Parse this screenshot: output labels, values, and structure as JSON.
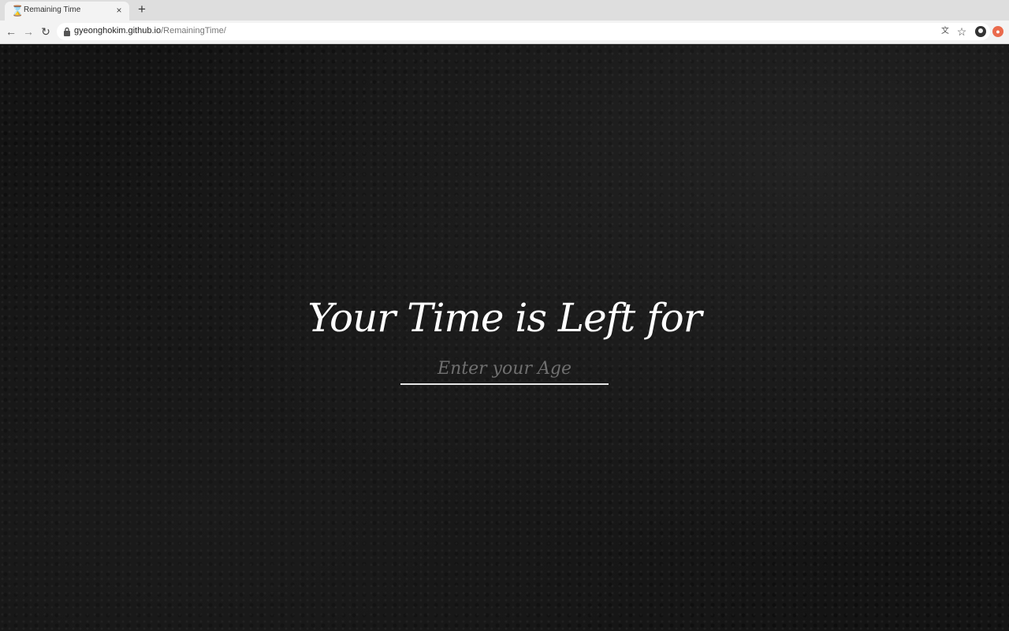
{
  "browser": {
    "tab": {
      "title": "Remaining Time",
      "favicon_icon": "hourglass-icon",
      "close_glyph": "×"
    },
    "new_tab_glyph": "+",
    "nav": {
      "back_glyph": "←",
      "forward_glyph": "→",
      "reload_glyph": "↻"
    },
    "address": {
      "host": "gyeonghokim.github.io",
      "path": "/RemainingTime/"
    },
    "star_glyph": "☆",
    "translate_glyph": "文"
  },
  "page": {
    "headline": "Your Time is Left for",
    "age_input": {
      "value": "",
      "placeholder": "Enter your Age"
    }
  },
  "colors": {
    "background": "#141414",
    "text": "#ffffff",
    "placeholder": "#6f6f6f",
    "underline": "#e6e6e6"
  }
}
